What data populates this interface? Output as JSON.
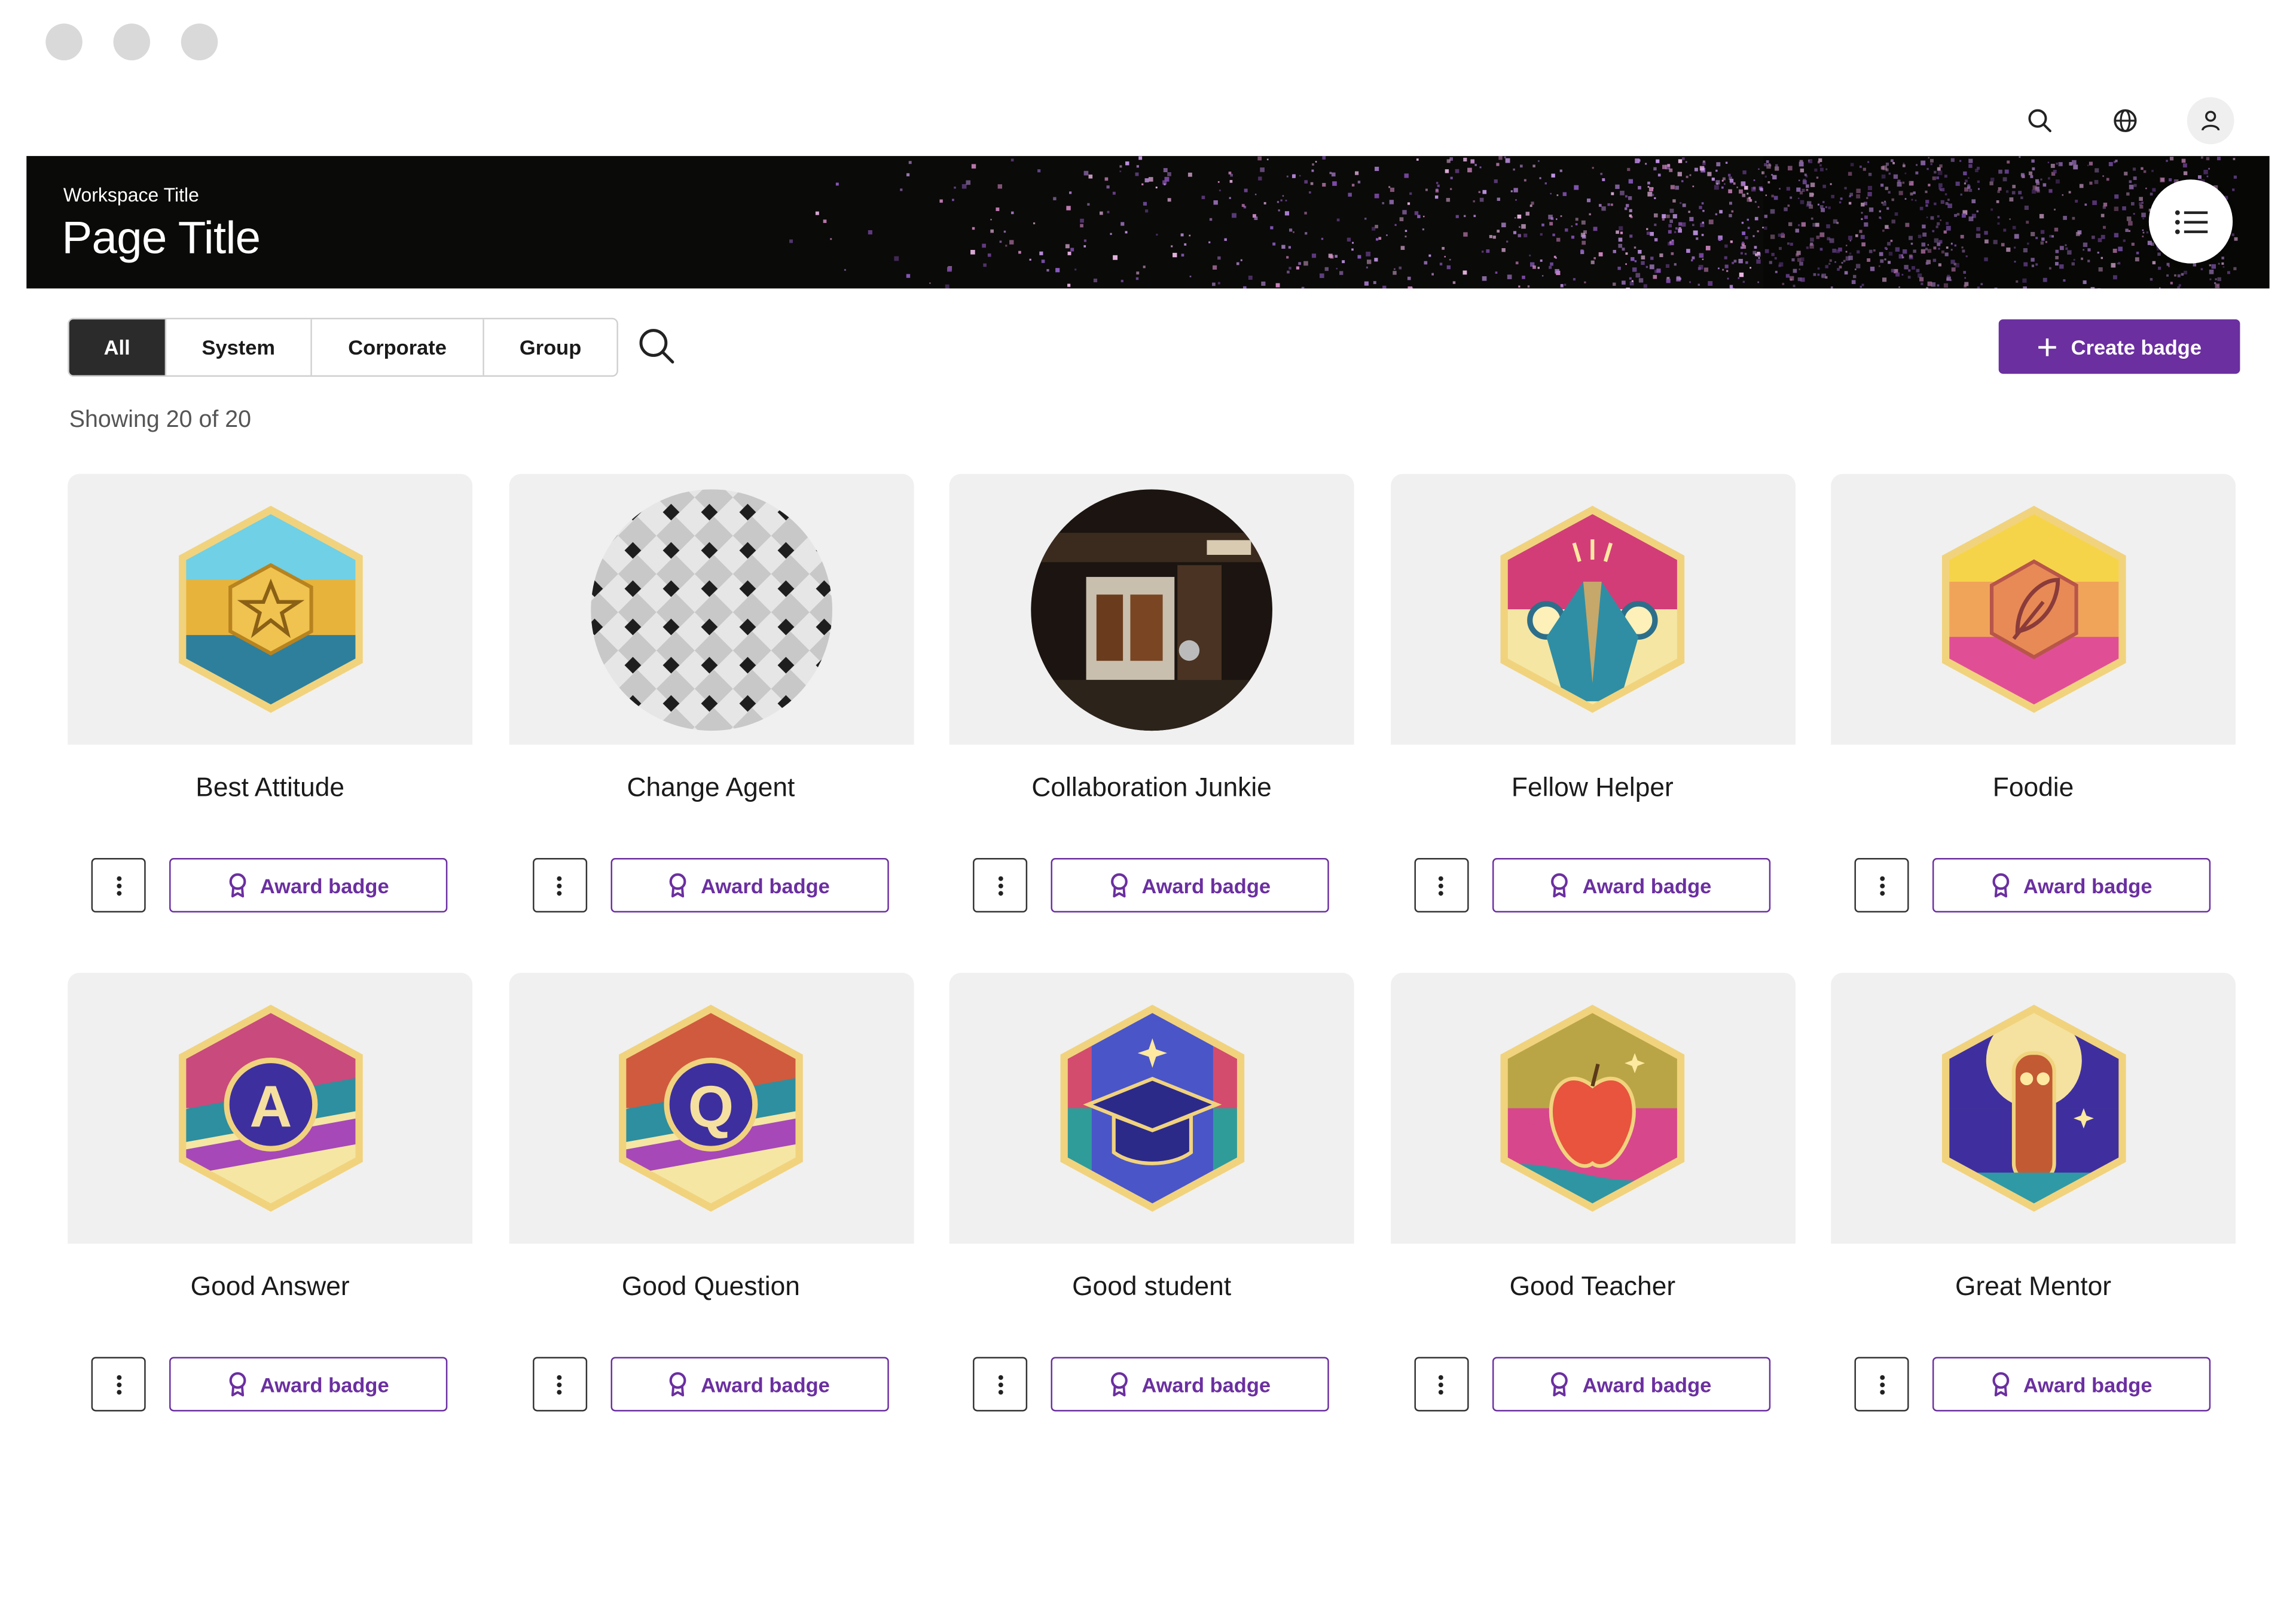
{
  "header": {
    "workspace_title": "Workspace Title",
    "page_title": "Page Title"
  },
  "filters": {
    "tabs": [
      {
        "label": "All",
        "active": true
      },
      {
        "label": "System",
        "active": false
      },
      {
        "label": "Corporate",
        "active": false
      },
      {
        "label": "Group",
        "active": false
      }
    ]
  },
  "actions": {
    "create_label": "Create badge"
  },
  "results": {
    "summary": "Showing 20 of 20"
  },
  "badges": [
    {
      "name": "Best Attitude",
      "award_label": "Award badge",
      "icon": "star-hexagon-badge"
    },
    {
      "name": "Change Agent",
      "award_label": "Award badge",
      "icon": "geometric-pattern-photo"
    },
    {
      "name": "Collaboration Junkie",
      "award_label": "Award badge",
      "icon": "storefront-photo"
    },
    {
      "name": "Fellow Helper",
      "award_label": "Award badge",
      "icon": "high-five-hexagon-badge"
    },
    {
      "name": "Foodie",
      "award_label": "Award badge",
      "icon": "leaf-hexagon-badge"
    },
    {
      "name": "Good Answer",
      "award_label": "Award badge",
      "icon": "answer-bubble-hexagon-badge"
    },
    {
      "name": "Good Question",
      "award_label": "Award badge",
      "icon": "question-bubble-hexagon-badge"
    },
    {
      "name": "Good student",
      "award_label": "Award badge",
      "icon": "graduation-cap-hexagon-badge"
    },
    {
      "name": "Good Teacher",
      "award_label": "Award badge",
      "icon": "apple-hexagon-badge"
    },
    {
      "name": "Great Mentor",
      "award_label": "Award badge",
      "icon": "owl-hexagon-badge"
    }
  ],
  "colors": {
    "accent": "#6b2fa0",
    "active_tab": "#2b2b2b",
    "banner_bg": "#0a0a08",
    "card_bg": "#f0f0f0"
  }
}
